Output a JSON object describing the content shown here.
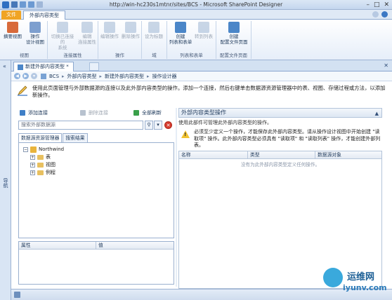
{
  "window": {
    "title": "http://win-hc230s1mtnr/sites/BCS - Microsoft SharePoint Designer",
    "controls": [
      "–",
      "□",
      "✕"
    ]
  },
  "ribbon": {
    "file_tab": "文件",
    "active_tab": "外部内容类型",
    "groups": [
      {
        "title": "视图",
        "buttons": [
          {
            "label": "摘要视图",
            "enabled": true
          },
          {
            "label": "操作\n设计视图",
            "enabled": true
          }
        ]
      },
      {
        "title": "连接属性",
        "buttons": [
          {
            "label": "切换已连接的\n系统",
            "enabled": false
          },
          {
            "label": "编辑\n连接属性",
            "enabled": false
          }
        ]
      },
      {
        "title": "操作",
        "buttons": [
          {
            "label": "编辑操作",
            "enabled": false
          },
          {
            "label": "删除操作",
            "enabled": false
          }
        ]
      },
      {
        "title": "域",
        "buttons": [
          {
            "label": "设为标题",
            "enabled": false
          }
        ]
      },
      {
        "title": "列表和表单",
        "buttons": [
          {
            "label": "创建\n列表和表单",
            "enabled": true
          },
          {
            "label": "转到列表",
            "enabled": false
          }
        ]
      },
      {
        "title": "配置文件页面",
        "buttons": [
          {
            "label": "创建\n配置文件页面",
            "enabled": true
          }
        ]
      }
    ]
  },
  "leftnav": {
    "label": "导航",
    "chevron": "«"
  },
  "doc_tab": {
    "label": "新建外部内容类型 *",
    "close": "✕"
  },
  "breadcrumb": {
    "items": [
      "BCS",
      "外部内容类型",
      "新建外部内容类型",
      "操作设计器"
    ],
    "separator": "▸"
  },
  "description": "使用此页面管理与外部数据源的连接以及此外部内容类型的操作。添加一个连接，然后右键单击数据源资源管理器中的表、视图、存储过程或方法，以添加新操作。",
  "data_source": {
    "add_connection": "添加连接",
    "remove_connection": "删除连接",
    "refresh_all": "全部刷新",
    "search_placeholder": "搜索外部数据源",
    "tabs": [
      "数据源资源管理器",
      "搜索结果"
    ],
    "tree": [
      {
        "label": "Northwind",
        "level": 0,
        "expander": "−"
      },
      {
        "label": "表",
        "level": 1,
        "expander": "+"
      },
      {
        "label": "视图",
        "level": 1,
        "expander": "+"
      },
      {
        "label": "例程",
        "level": 1,
        "expander": "+"
      }
    ],
    "properties_headers": [
      "属性",
      "值"
    ]
  },
  "operations": {
    "title": "外部内容类型操作",
    "subtitle": "使用此部件可管理此外部内容类型的操作。",
    "warning": "必须至少定义一个操作，才能保存此外部内容类型。请从操作设计视图中开始创建 \"读取项\" 操作。此外部内容类型必须具有 \"读取项\" 和 \"读取列表\" 操作，才能创建外部列表。",
    "columns": [
      "名称",
      "类型",
      "数据源对象"
    ],
    "empty_text": "没有为此外部内容类型定义任何操作。"
  },
  "watermark": {
    "line1": "运维网",
    "line2": "iyunv.com"
  },
  "colors": {
    "file_tab": "#f0a424",
    "accent": "#2f6fc1",
    "warning": "#f1c22e"
  }
}
